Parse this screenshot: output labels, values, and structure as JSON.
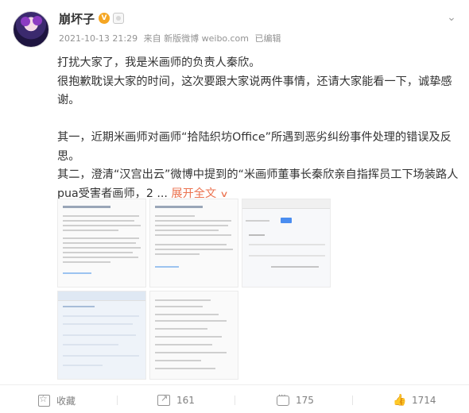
{
  "user": {
    "name": "崩坏子",
    "verified_badge": "V",
    "avatar_icon": "anime-character-avatar"
  },
  "meta": {
    "datetime": "2021-10-13 21:29",
    "source": "来自 新版微博 weibo.com",
    "edited": "已编辑"
  },
  "post": {
    "lines": [
      "打扰大家了，我是米画师的负责人秦欣。",
      "很抱歉耽误大家的时间，这次要跟大家说两件事情，还请大家能看一下，诚挚感谢。",
      "",
      "其一，近期米画师对画师“拾陆织坊Office”所遇到恶劣纠纷事件处理的错误及反思。",
      "其二，澄清“汉宫出云”微博中提到的“米画师董事长秦欣亲自指挥员工下场装路人pua受害者画师，2 ..."
    ],
    "expand_label": "展开全文",
    "expand_icon": "chevron-down-icon"
  },
  "images": {
    "count": 5,
    "descriptions": []
  },
  "actions": {
    "favorite_label": "收藏",
    "repost_count": "161",
    "comment_count": "175",
    "like_count": "1714"
  },
  "colors": {
    "accent": "#eb7350",
    "verified": "#f5a623",
    "text": "#333333",
    "meta": "#939393"
  }
}
